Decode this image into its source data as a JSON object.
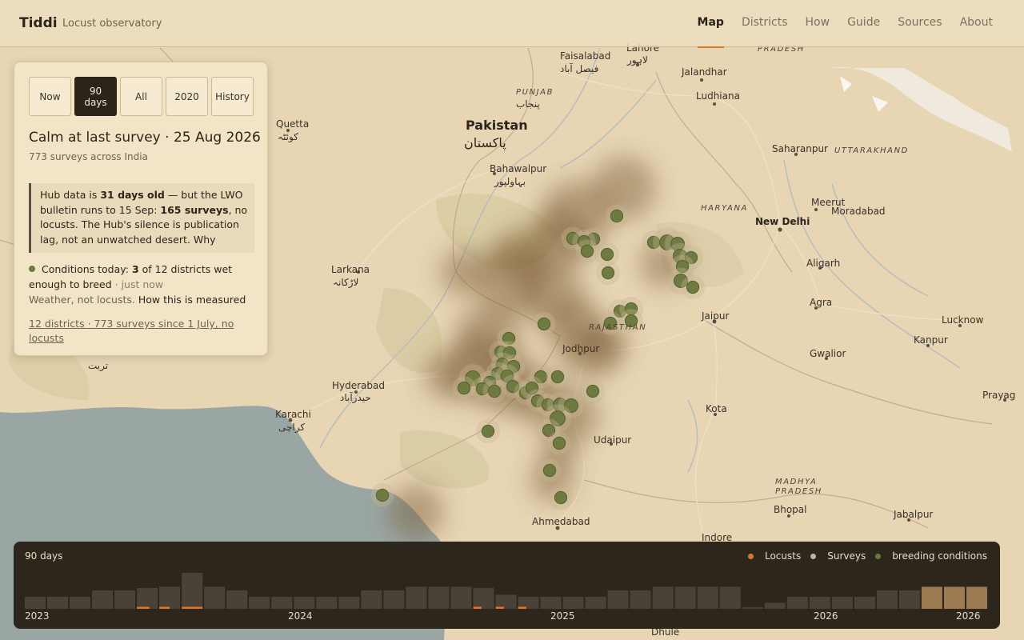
{
  "header": {
    "brand": "Tiddi",
    "tagline": "Locust observatory",
    "nav": [
      {
        "label": "Map",
        "active": true
      },
      {
        "label": "Districts",
        "active": false
      },
      {
        "label": "How",
        "active": false
      },
      {
        "label": "Guide",
        "active": false
      },
      {
        "label": "Sources",
        "active": false
      },
      {
        "label": "About",
        "active": false
      }
    ]
  },
  "panel": {
    "range_tabs": [
      {
        "label": "Now",
        "active": false
      },
      {
        "label": "90 days",
        "active": true
      },
      {
        "label": "All",
        "active": false
      },
      {
        "label": "2020",
        "active": false
      },
      {
        "label": "History",
        "active": false
      }
    ],
    "headline": "Calm at last survey · 25 Aug 2026",
    "subline": "773 surveys across India",
    "note": {
      "p1": "Hub data is ",
      "b1": "31 days old",
      "p2": " — but the LWO bulletin runs to 15 Sep: ",
      "b2": "165 surveys",
      "p3": ", no locusts. The Hub's silence is publication lag, not an unwatched desert. Why"
    },
    "conditions": {
      "prefix": "Conditions today: ",
      "count": "3",
      "suffix": " of 12 districts wet enough to breed",
      "time": " · just now"
    },
    "weather": {
      "text": "Weather, not locusts.",
      "link": "How this is measured"
    },
    "footer_link": "12 districts · 773 surveys since 1 July, no locusts"
  },
  "map": {
    "labels": [
      {
        "text": "Faisalabad",
        "kind": "city"
      },
      {
        "text": "فیصل آباد",
        "kind": "native"
      },
      {
        "text": "Lahore",
        "kind": "city"
      },
      {
        "text": "لاہور",
        "kind": "native"
      },
      {
        "text": "Jalandhar",
        "kind": "city"
      },
      {
        "text": "Ludhiana",
        "kind": "city"
      },
      {
        "text": "PUNJAB",
        "kind": "region"
      },
      {
        "text": "پنجاب",
        "kind": "native"
      },
      {
        "text": "Pakistan",
        "kind": "country"
      },
      {
        "text": "پاکستان",
        "kind": "country-native"
      },
      {
        "text": "Quetta",
        "kind": "city"
      },
      {
        "text": "کوئٹہ",
        "kind": "native"
      },
      {
        "text": "Bahawalpur",
        "kind": "city"
      },
      {
        "text": "بہاولپور",
        "kind": "native"
      },
      {
        "text": "Saharanpur",
        "kind": "city"
      },
      {
        "text": "UTTARAKHAND",
        "kind": "region"
      },
      {
        "text": "HARYANA",
        "kind": "region"
      },
      {
        "text": "Meerut",
        "kind": "city"
      },
      {
        "text": "Moradabad",
        "kind": "city"
      },
      {
        "text": "New Delhi",
        "kind": "bold"
      },
      {
        "text": "Larkana",
        "kind": "city"
      },
      {
        "text": "لاڑکانہ",
        "kind": "native"
      },
      {
        "text": "Aligarh",
        "kind": "city"
      },
      {
        "text": "Agra",
        "kind": "city"
      },
      {
        "text": "Lucknow",
        "kind": "city"
      },
      {
        "text": "Jaipur",
        "kind": "city"
      },
      {
        "text": "RAJASTHAN",
        "kind": "region"
      },
      {
        "text": "Jodhpur",
        "kind": "city"
      },
      {
        "text": "Kanpur",
        "kind": "city"
      },
      {
        "text": "Gwalior",
        "kind": "city"
      },
      {
        "text": "Hyderabad",
        "kind": "city"
      },
      {
        "text": "حیدرآباد",
        "kind": "native"
      },
      {
        "text": "Karachi",
        "kind": "city"
      },
      {
        "text": "کراچی",
        "kind": "native"
      },
      {
        "text": "Kota",
        "kind": "city"
      },
      {
        "text": "Prayag",
        "kind": "city"
      },
      {
        "text": "Udaipur",
        "kind": "city"
      },
      {
        "text": "MADHYA",
        "kind": "region"
      },
      {
        "text": "PRADESH",
        "kind": "region"
      },
      {
        "text": "PRADESH",
        "kind": "region"
      },
      {
        "text": "Bhopal",
        "kind": "city"
      },
      {
        "text": "Jabalpur",
        "kind": "city"
      },
      {
        "text": "Ahmedabad",
        "kind": "city"
      },
      {
        "text": "Indore",
        "kind": "city"
      },
      {
        "text": "تربت",
        "kind": "native"
      },
      {
        "text": "Dhule",
        "kind": "city"
      }
    ]
  },
  "timeline": {
    "title": "90 days",
    "legend": [
      {
        "label": "Locusts",
        "color": "#d9782a"
      },
      {
        "label": "Surveys",
        "color": "#bfb5a4"
      },
      {
        "label": "breeding conditions",
        "color": "#6b7a3b"
      }
    ],
    "years": [
      "2023",
      "2024",
      "2025",
      "2026",
      "2026"
    ],
    "bars": [
      {
        "v": 0.3,
        "locust": 0
      },
      {
        "v": 0.3,
        "locust": 0
      },
      {
        "v": 0.3,
        "locust": 0
      },
      {
        "v": 0.46,
        "locust": 0
      },
      {
        "v": 0.46,
        "locust": 0
      },
      {
        "v": 0.52,
        "locust": 0.6
      },
      {
        "v": 0.55,
        "locust": 0.5
      },
      {
        "v": 0.9,
        "locust": 1.0
      },
      {
        "v": 0.55,
        "locust": 0
      },
      {
        "v": 0.46,
        "locust": 0
      },
      {
        "v": 0.3,
        "locust": 0
      },
      {
        "v": 0.3,
        "locust": 0
      },
      {
        "v": 0.3,
        "locust": 0
      },
      {
        "v": 0.3,
        "locust": 0
      },
      {
        "v": 0.3,
        "locust": 0
      },
      {
        "v": 0.46,
        "locust": 0
      },
      {
        "v": 0.46,
        "locust": 0
      },
      {
        "v": 0.55,
        "locust": 0
      },
      {
        "v": 0.55,
        "locust": 0
      },
      {
        "v": 0.55,
        "locust": 0
      },
      {
        "v": 0.52,
        "locust": 0.4
      },
      {
        "v": 0.35,
        "locust": 0.4
      },
      {
        "v": 0.3,
        "locust": 0.4
      },
      {
        "v": 0.3,
        "locust": 0
      },
      {
        "v": 0.3,
        "locust": 0
      },
      {
        "v": 0.3,
        "locust": 0
      },
      {
        "v": 0.46,
        "locust": 0
      },
      {
        "v": 0.46,
        "locust": 0
      },
      {
        "v": 0.55,
        "locust": 0
      },
      {
        "v": 0.55,
        "locust": 0
      },
      {
        "v": 0.55,
        "locust": 0
      },
      {
        "v": 0.55,
        "locust": 0
      },
      {
        "v": 0.02,
        "locust": 0
      },
      {
        "v": 0.15,
        "locust": 0
      },
      {
        "v": 0.3,
        "locust": 0
      },
      {
        "v": 0.3,
        "locust": 0
      },
      {
        "v": 0.3,
        "locust": 0
      },
      {
        "v": 0.3,
        "locust": 0
      },
      {
        "v": 0.46,
        "locust": 0
      },
      {
        "v": 0.46,
        "locust": 0
      },
      {
        "v": 0.55,
        "locust": 0,
        "highlight": true
      },
      {
        "v": 0.55,
        "locust": 0,
        "highlight": true
      },
      {
        "v": 0.55,
        "locust": 0,
        "highlight": true
      }
    ]
  },
  "points": [
    [
      771,
      270,
      0.9
    ],
    [
      716,
      298,
      0.9
    ],
    [
      742,
      299,
      0.9
    ],
    [
      730,
      302,
      0.9
    ],
    [
      734,
      314,
      0.9
    ],
    [
      759,
      318,
      0.9
    ],
    [
      760,
      341,
      0.9
    ],
    [
      817,
      303,
      0.9
    ],
    [
      834,
      303,
      1.1
    ],
    [
      847,
      305,
      1.0
    ],
    [
      850,
      320,
      1.0
    ],
    [
      864,
      322,
      0.9
    ],
    [
      853,
      333,
      0.9
    ],
    [
      851,
      351,
      1.0
    ],
    [
      866,
      359,
      0.9
    ],
    [
      775,
      389,
      0.9
    ],
    [
      789,
      386,
      0.9
    ],
    [
      789,
      401,
      0.9
    ],
    [
      763,
      404,
      0.9
    ],
    [
      680,
      405,
      0.9
    ],
    [
      636,
      423,
      0.9
    ],
    [
      626,
      440,
      0.9
    ],
    [
      637,
      441,
      0.9
    ],
    [
      628,
      455,
      0.9
    ],
    [
      642,
      458,
      0.9
    ],
    [
      622,
      467,
      0.9
    ],
    [
      634,
      470,
      0.9
    ],
    [
      591,
      473,
      1.1
    ],
    [
      612,
      478,
      0.9
    ],
    [
      603,
      486,
      0.9
    ],
    [
      580,
      485,
      0.9
    ],
    [
      618,
      489,
      0.9
    ],
    [
      641,
      483,
      0.9
    ],
    [
      657,
      491,
      0.9
    ],
    [
      676,
      471,
      0.9
    ],
    [
      697,
      471,
      0.9
    ],
    [
      665,
      485,
      0.9
    ],
    [
      672,
      501,
      0.9
    ],
    [
      685,
      506,
      0.9
    ],
    [
      700,
      506,
      1.0
    ],
    [
      714,
      507,
      1.0
    ],
    [
      697,
      523,
      1.1
    ],
    [
      741,
      489,
      0.9
    ],
    [
      686,
      538,
      0.9
    ],
    [
      699,
      554,
      0.9
    ],
    [
      610,
      539,
      0.9
    ],
    [
      687,
      588,
      0.9
    ],
    [
      701,
      622,
      0.9
    ],
    [
      478,
      619,
      0.9
    ]
  ],
  "heat": [
    [
      780,
      235,
      40
    ],
    [
      720,
      270,
      45
    ],
    [
      700,
      300,
      40
    ],
    [
      650,
      320,
      35
    ],
    [
      640,
      350,
      45
    ],
    [
      690,
      370,
      40
    ],
    [
      720,
      410,
      38
    ],
    [
      740,
      440,
      35
    ],
    [
      610,
      420,
      40
    ],
    [
      600,
      460,
      45
    ],
    [
      640,
      480,
      40
    ],
    [
      680,
      500,
      35
    ],
    [
      720,
      520,
      30
    ],
    [
      700,
      560,
      25
    ],
    [
      690,
      600,
      28
    ],
    [
      520,
      640,
      35
    ],
    [
      760,
      430,
      25
    ],
    [
      830,
      330,
      30
    ],
    [
      580,
      340,
      30
    ],
    [
      560,
      470,
      30
    ]
  ]
}
